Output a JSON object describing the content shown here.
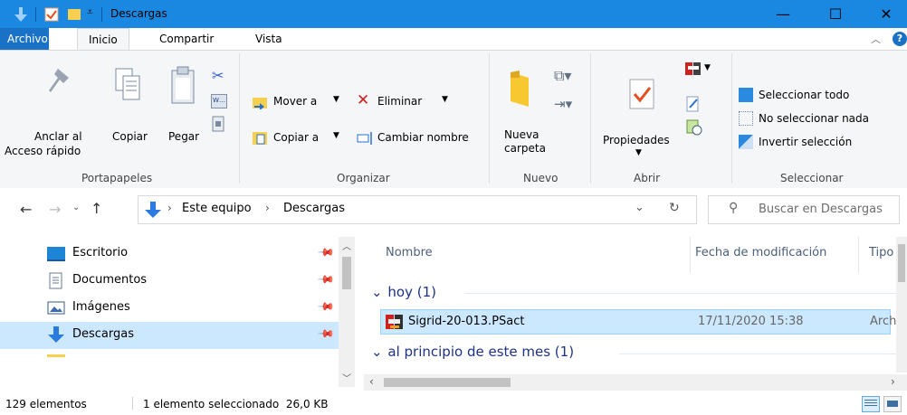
{
  "window": {
    "title": "Descargas",
    "controls": {
      "minimize": "—",
      "maximize": "☐",
      "close": "✕"
    }
  },
  "ribbon_tabs": [
    "Archivo",
    "Inicio",
    "Compartir",
    "Vista"
  ],
  "ribbon": {
    "portapapeles": {
      "label": "Portapapeles",
      "pin_label_1": "Anclar al",
      "pin_label_2": "Acceso rápido",
      "copy": "Copiar",
      "paste": "Pegar"
    },
    "organizar": {
      "label": "Organizar",
      "move_to": "Mover a",
      "copy_to": "Copiar a",
      "delete": "Eliminar",
      "rename": "Cambiar nombre"
    },
    "nuevo": {
      "label": "Nuevo",
      "new_folder_1": "Nueva",
      "new_folder_2": "carpeta"
    },
    "abrir": {
      "label": "Abrir",
      "properties": "Propiedades"
    },
    "seleccionar": {
      "label": "Seleccionar",
      "select_all": "Seleccionar todo",
      "select_none": "No seleccionar nada",
      "invert": "Invertir selección"
    }
  },
  "address": {
    "crumbs": [
      "Este equipo",
      "Descargas"
    ],
    "search_placeholder": "Buscar en Descargas"
  },
  "nav": [
    {
      "label": "Escritorio",
      "icon": "desktop-icon"
    },
    {
      "label": "Documentos",
      "icon": "documents-icon"
    },
    {
      "label": "Imágenes",
      "icon": "pictures-icon"
    },
    {
      "label": "Descargas",
      "icon": "downloads-icon",
      "selected": true
    }
  ],
  "columns": {
    "name": "Nombre",
    "date": "Fecha de modificación",
    "type": "Tipo"
  },
  "groups": [
    {
      "header": "hoy (1)",
      "files": [
        {
          "name": "Sigrid-20-013.PSact",
          "date": "17/11/2020 15:38",
          "type": "Arch"
        }
      ]
    },
    {
      "header": "al principio de este mes (1)",
      "files": []
    }
  ],
  "status": {
    "count": "129 elementos",
    "selection": "1 elemento seleccionado  26,0 KB"
  },
  "colors": {
    "titlebar": "#1a88e0",
    "accent": "#0078d7",
    "selected_row": "#cce8ff",
    "group_header": "#1e3287"
  }
}
